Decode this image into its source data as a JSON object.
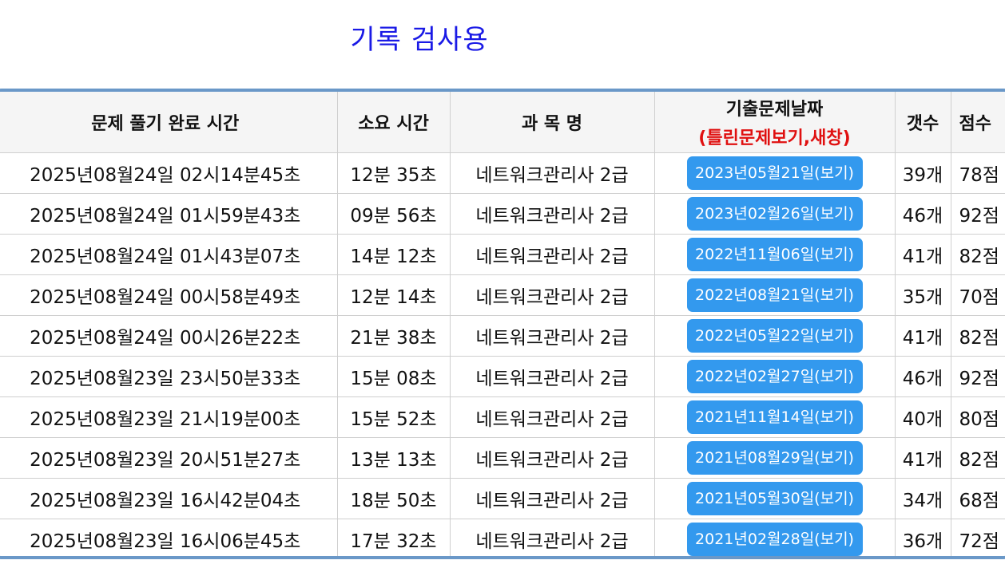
{
  "page": {
    "title": "기록 검사용"
  },
  "table": {
    "headers": {
      "completed_time": "문제 풀기 완료 시간",
      "duration": "소요 시간",
      "subject": "과 목 명",
      "exam_date": "기출문제날짜",
      "exam_date_sub": "(틀린문제보기,새창)",
      "count": "갯수",
      "score": "점수"
    },
    "rows": [
      {
        "completed_time": "2025년08월24일 02시14분45초",
        "duration": "12분 35초",
        "subject": "네트워크관리사 2급",
        "exam_date": "2023년05월21일(보기)",
        "count": "39개",
        "score": "78점"
      },
      {
        "completed_time": "2025년08월24일 01시59분43초",
        "duration": "09분 56초",
        "subject": "네트워크관리사 2급",
        "exam_date": "2023년02월26일(보기)",
        "count": "46개",
        "score": "92점"
      },
      {
        "completed_time": "2025년08월24일 01시43분07초",
        "duration": "14분 12초",
        "subject": "네트워크관리사 2급",
        "exam_date": "2022년11월06일(보기)",
        "count": "41개",
        "score": "82점"
      },
      {
        "completed_time": "2025년08월24일 00시58분49초",
        "duration": "12분 14초",
        "subject": "네트워크관리사 2급",
        "exam_date": "2022년08월21일(보기)",
        "count": "35개",
        "score": "70점"
      },
      {
        "completed_time": "2025년08월24일 00시26분22초",
        "duration": "21분 38초",
        "subject": "네트워크관리사 2급",
        "exam_date": "2022년05월22일(보기)",
        "count": "41개",
        "score": "82점"
      },
      {
        "completed_time": "2025년08월23일 23시50분33초",
        "duration": "15분 08초",
        "subject": "네트워크관리사 2급",
        "exam_date": "2022년02월27일(보기)",
        "count": "46개",
        "score": "92점"
      },
      {
        "completed_time": "2025년08월23일 21시19분00초",
        "duration": "15분 52초",
        "subject": "네트워크관리사 2급",
        "exam_date": "2021년11월14일(보기)",
        "count": "40개",
        "score": "80점"
      },
      {
        "completed_time": "2025년08월23일 20시51분27초",
        "duration": "13분 13초",
        "subject": "네트워크관리사 2급",
        "exam_date": "2021년08월29일(보기)",
        "count": "41개",
        "score": "82점"
      },
      {
        "completed_time": "2025년08월23일 16시42분04초",
        "duration": "18분 50초",
        "subject": "네트워크관리사 2급",
        "exam_date": "2021년05월30일(보기)",
        "count": "34개",
        "score": "68점"
      },
      {
        "completed_time": "2025년08월23일 16시06분45초",
        "duration": "17분 32초",
        "subject": "네트워크관리사 2급",
        "exam_date": "2021년02월28일(보기)",
        "count": "36개",
        "score": "72점"
      }
    ]
  },
  "colors": {
    "title": "#1a1ae6",
    "header_sub": "#e01010",
    "button_bg": "#3399ee",
    "table_border": "#6a98c8"
  }
}
